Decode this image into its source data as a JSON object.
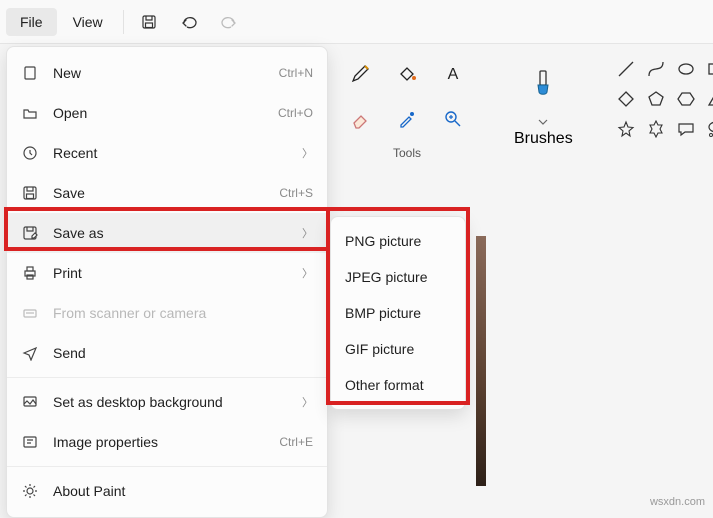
{
  "menubar": {
    "file": "File",
    "view": "View"
  },
  "file_menu": {
    "new": {
      "label": "New",
      "accel": "Ctrl+N"
    },
    "open": {
      "label": "Open",
      "accel": "Ctrl+O"
    },
    "recent": {
      "label": "Recent"
    },
    "save": {
      "label": "Save",
      "accel": "Ctrl+S"
    },
    "save_as": {
      "label": "Save as"
    },
    "print": {
      "label": "Print"
    },
    "scanner": {
      "label": "From scanner or camera"
    },
    "send": {
      "label": "Send"
    },
    "wallpaper": {
      "label": "Set as desktop background"
    },
    "props": {
      "label": "Image properties",
      "accel": "Ctrl+E"
    },
    "about": {
      "label": "About Paint"
    }
  },
  "save_as_submenu": {
    "png": "PNG picture",
    "jpeg": "JPEG picture",
    "bmp": "BMP picture",
    "gif": "GIF picture",
    "other": "Other format"
  },
  "toolbar_labels": {
    "tools": "Tools",
    "brushes": "Brushes"
  },
  "watermark": "wsxdn.com"
}
